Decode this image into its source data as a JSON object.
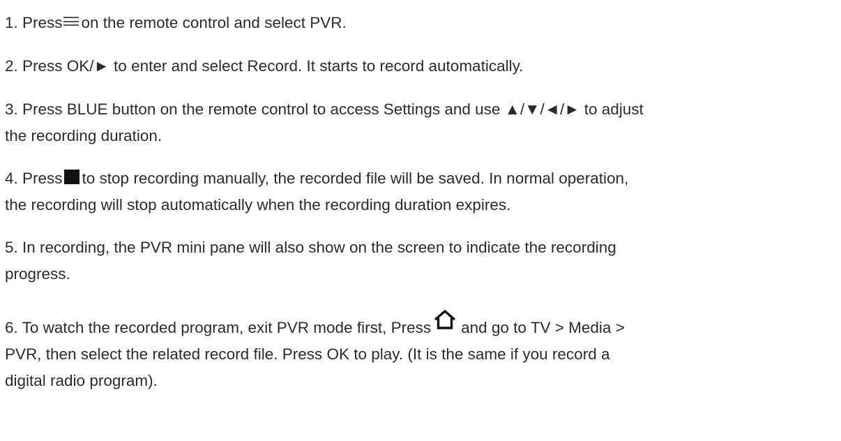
{
  "steps": [
    {
      "parts": [
        "1. Press",
        "on the remote control and select PVR."
      ]
    },
    {
      "text": "2. Press OK/► to enter and select Record. It starts to record automatically."
    },
    {
      "lines": [
        "3. Press BLUE button on the remote control to access Settings and use ▲/▼/◄/► to adjust",
        "the recording duration."
      ]
    },
    {
      "parts": [
        "4. Press",
        "to stop recording manually, the recorded file will be saved. In normal operation,"
      ],
      "line2": "the recording will stop automatically when the recording duration expires."
    },
    {
      "lines": [
        "5. In recording, the PVR mini pane will also show on the screen to indicate the recording",
        "progress."
      ]
    },
    {
      "parts": [
        "6. To watch the recorded program, exit PVR mode first, Press",
        "and go to TV > Media >"
      ],
      "lines": [
        "PVR, then select the related record file. Press OK to play. (It is the same if you record a",
        "digital radio program)."
      ]
    }
  ],
  "icons": {
    "menu": "menu-icon",
    "stop": "stop-icon",
    "home": "home-icon"
  }
}
